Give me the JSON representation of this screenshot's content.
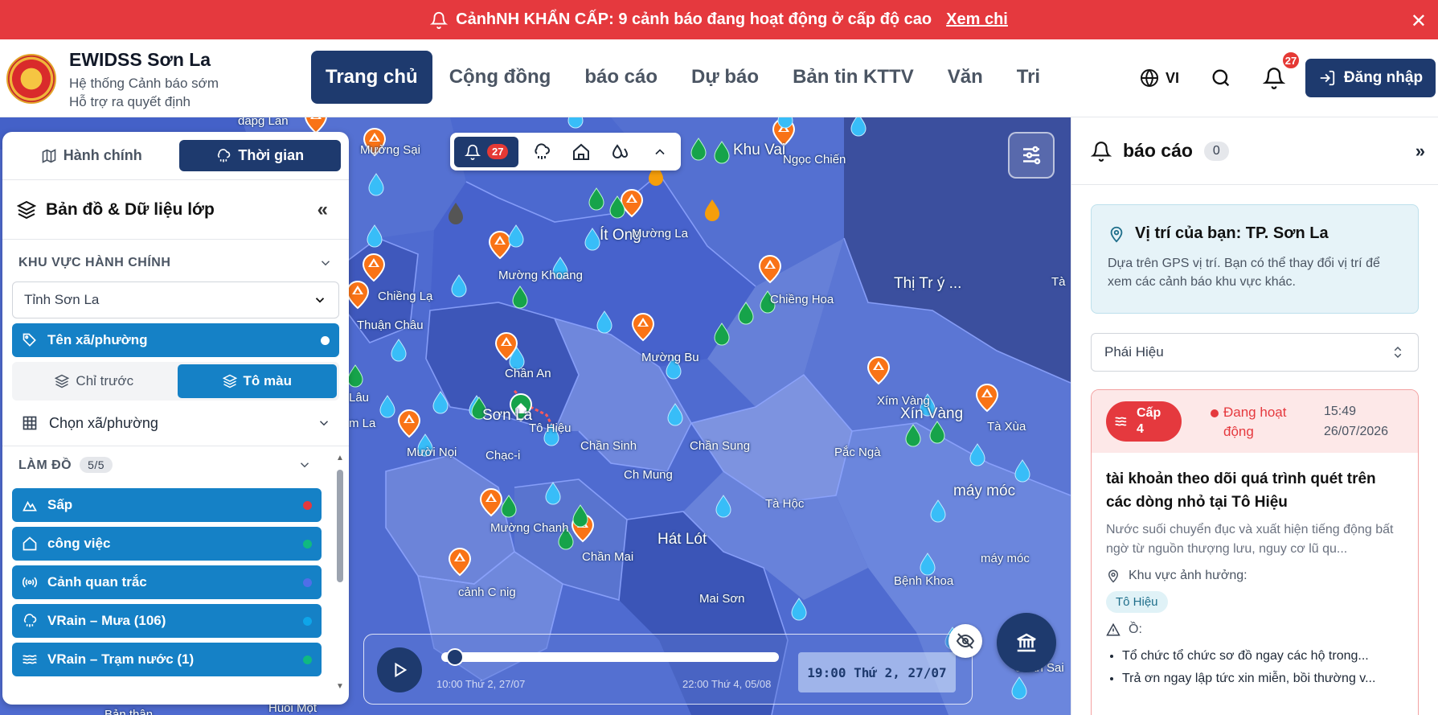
{
  "banner": {
    "text": "CảnhNH KHẨN CẤP:  9 cảnh báo đang hoạt động ở cấp độ cao",
    "link": "Xem chi",
    "close": "✕"
  },
  "header": {
    "title": "EWIDSS Sơn La",
    "subtitle1": "Hệ thống Cảnh báo sớm",
    "subtitle2": "Hỗ trợ ra quyết định",
    "nav": [
      "Trang chủ",
      "Cộng đồng",
      "báo cáo",
      "Dự báo",
      "Bản tin KTTV",
      "Văn",
      "Tri"
    ],
    "lang": "VI",
    "notif_count": "27",
    "login": "Đăng nhập"
  },
  "left": {
    "tab1": "Hành chính",
    "tab2": "Thời gian",
    "title": "Bản đồ & Dữ liệu lớp",
    "sec1": "KHU VỰC HÀNH CHÍNH",
    "province": "Tỉnh Sơn La",
    "commune_names": "Tên xã/phường",
    "seg1": "Chỉ trước",
    "seg2": "Tô màu",
    "choose": "Chọn xã/phường",
    "sec2": "LÀM ĐỒ",
    "sec2_count": "5/5",
    "layers": [
      {
        "label": "Sấp",
        "color": "#e5393e"
      },
      {
        "label": "công việc",
        "color": "#10b981"
      },
      {
        "label": "Cảnh quan trắc",
        "color": "#4f6ee8"
      },
      {
        "label": "VRain – Mưa (106)",
        "color": "#0ea5e9"
      },
      {
        "label": "VRain – Trạm nước (1)",
        "color": "#10b981"
      }
    ]
  },
  "maptool": {
    "count": "27"
  },
  "map_labels": [
    "dapg Lan",
    "Mường Sại",
    "Khu Vai",
    "Ngọc Chiến",
    "Ít Ong",
    "Mường La",
    "Mường Khoang",
    "Chiềng Hoa",
    "Thị Tr ý ...",
    "Chiềng Lạ",
    "Thuận Châu",
    "Mường Bu",
    "Chần An",
    "Xím Vàng",
    "Xín Vàng",
    "Tà Xùa",
    "Sơn La",
    "Tô Hiệu",
    "Chạc-i",
    "Chần Sinh",
    "Chần Sung",
    "Pắc Ngà",
    "Mười Nọi",
    "Ch Mung",
    "máy móc",
    "Mường Chanh",
    "Tà Hộc",
    "Hát Lót",
    "Chần Mai",
    "máy móc",
    "Bệnh Khoa",
    "cảnh C nig",
    "Mai Sơn",
    "Lâu",
    "m La",
    "Chân Sai",
    "Bản thân",
    "Huổi Một",
    "Tà"
  ],
  "timeline": {
    "start": "10:00 Thứ 2, 27/07",
    "end": "22:00 Thứ 4, 05/08",
    "current": "19:00 Thứ 2, 27/07",
    "progress": 0.04
  },
  "right": {
    "title": "báo cáo",
    "count": "0",
    "loc_title": "Vị trí của bạn: TP. Sơn La",
    "loc_desc": "Dựa trên GPS vị trí. Bạn có thể thay đổi vị trí để xem các cảnh báo khu vực khác.",
    "select": "Phái Hiệu",
    "card": {
      "level_a": "Cấp",
      "level_b": "4",
      "status_a": "Đang hoạt",
      "status_b": "động",
      "time": "15:49",
      "date": "26/07/2026",
      "title": "tài khoản theo dõi quá trình quét trên các dòng nhỏ tại Tô Hiệu",
      "desc": "Nước suối chuyển đục và xuất hiện tiếng động bất ngờ từ nguồn thượng lưu, nguy cơ lũ qu...",
      "area_label": "Khu vực ảnh hưởng:",
      "area_chip": "Tô Hiệu",
      "o_label": "Ồ:",
      "items": [
        "Tổ chức tổ chức sơ đồ ngay các hộ trong...",
        "Trả ơn ngay lập tức xin miễn, bồi thường v..."
      ]
    }
  }
}
